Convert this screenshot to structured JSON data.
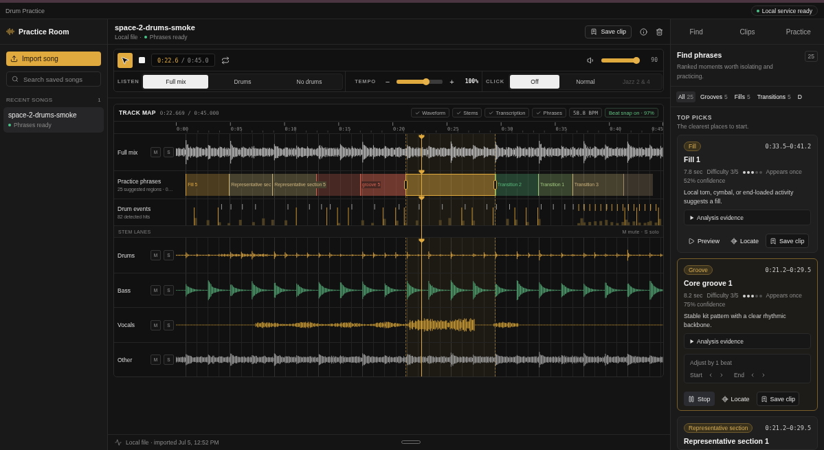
{
  "app": {
    "title": "Drum Practice",
    "service_status": "Local service ready"
  },
  "sidebar": {
    "brand": "Practice Room",
    "import_button": "Import song",
    "search": {
      "placeholder": "Search saved songs"
    },
    "recent_heading": "RECENT SONGS",
    "recent_count": "1",
    "songs": [
      {
        "name": "space-2-drums-smoke",
        "status": "Phrases ready",
        "selected": true
      }
    ]
  },
  "song": {
    "title": "space-2-drums-smoke",
    "source": "Local file",
    "separator": "·",
    "status": "Phrases ready",
    "save_button": "Save clip"
  },
  "transport": {
    "time": "0:22.6",
    "time_separator": "/",
    "duration": "0:45.0",
    "volume": {
      "level": 0.9,
      "reading": "90"
    }
  },
  "listen": {
    "label": "LISTEN",
    "options": [
      {
        "label": "Full mix",
        "selected": true
      },
      {
        "label": "Drums",
        "selected": false
      },
      {
        "label": "No drums",
        "selected": false
      }
    ]
  },
  "tempo": {
    "label": "TEMPO",
    "decrease": "−",
    "increase": "+",
    "level": 0.64,
    "reading": "100%"
  },
  "click": {
    "label": "CLICK",
    "options": [
      {
        "label": "Off",
        "selected": true,
        "disabled": false
      },
      {
        "label": "Normal",
        "selected": false,
        "disabled": false
      },
      {
        "label": "Jazz 2 & 4",
        "selected": false,
        "disabled": true
      }
    ]
  },
  "track_map": {
    "title": "TRACK MAP",
    "position": "0:22.669",
    "separator": "/",
    "duration": "0:45.000",
    "layers": [
      {
        "label": "Waveform",
        "checked": true
      },
      {
        "label": "Stems",
        "checked": true
      },
      {
        "label": "Transcription",
        "checked": true
      },
      {
        "label": "Phrases",
        "checked": true
      }
    ],
    "bpm": "58.8 BPM",
    "beat_snap": "Beat snap on · 97%",
    "ruler": [
      "0:00",
      "0:05",
      "0:10",
      "0:15",
      "0:20",
      "0:25",
      "0:30",
      "0:35",
      "0:40",
      "0:45"
    ],
    "playhead": {
      "level": 0.504
    },
    "full_mix": {
      "name": "Full mix",
      "mute": "M",
      "solo": "S"
    },
    "phrases": {
      "name": "Practice phrases",
      "detail": "25 suggested regions · 0…",
      "regions": [
        {
          "label": "Fill 5",
          "color": "#d9a441",
          "selected": false
        },
        {
          "label": "Representative sec",
          "color": "#c9b27a",
          "selected": false
        },
        {
          "label": "Representative section 5",
          "color": "#c9b27a",
          "selected": false
        },
        {
          "color": "#d0604f",
          "selected": false
        },
        {
          "label": "groove 5",
          "color": "#d0604f",
          "selected": false
        },
        {
          "color": "#e0aa3e",
          "selected": true
        },
        {
          "label": "Transition 2",
          "color": "#57b87a",
          "selected": false
        },
        {
          "label": "Transition 1",
          "color": "#9cc27a",
          "selected": false
        },
        {
          "label": "Transition 3",
          "color": "#c9b27a",
          "selected": false
        },
        {
          "color": "#a08a6a",
          "selected": false
        }
      ]
    },
    "drum_events": {
      "name": "Drum events",
      "detail": "82 detected hits"
    },
    "stem_heading": "STEM LANES",
    "stem_hint": "M mute · S solo",
    "stems": [
      {
        "name": "Drums",
        "mute": "M",
        "solo": "S",
        "color": "#d9a441"
      },
      {
        "name": "Bass",
        "mute": "M",
        "solo": "S",
        "color": "#4f9e6e"
      },
      {
        "name": "Vocals",
        "mute": "M",
        "solo": "S",
        "color": "#c99a34"
      },
      {
        "name": "Other",
        "mute": "M",
        "solo": "S",
        "color": "#9d9d9d"
      }
    ]
  },
  "status_bar": {
    "text": "Local file · imported Jul 5, 12:52 PM"
  },
  "panel": {
    "tabs": [
      {
        "label": "Find"
      },
      {
        "label": "Clips"
      },
      {
        "label": "Practice"
      }
    ],
    "title": "Find phrases",
    "subtitle": "Ranked moments worth isolating and practicing.",
    "count": "25",
    "filters": [
      {
        "label": "All",
        "count": "25",
        "selected": true
      },
      {
        "label": "Grooves",
        "count": "5",
        "selected": false
      },
      {
        "label": "Fills",
        "count": "5",
        "selected": false
      },
      {
        "label": "Transitions",
        "count": "5",
        "selected": false
      },
      {
        "label": "D",
        "selected": false
      }
    ],
    "section_heading": "TOP PICKS",
    "section_subtitle": "The clearest places to start.",
    "cards": [
      {
        "tag": "Fill",
        "range": "0:33.5–0:41.2",
        "title": "Fill 1",
        "duration": "7.8 sec",
        "difficulty": "Difficulty 3/5",
        "stars": 3,
        "repeats": "Appears once",
        "confidence": "52% confidence",
        "description": "Local tom, cymbal, or end-loaded activity suggests a fill.",
        "evidence": {
          "label": "Analysis evidence",
          "expanded": false
        },
        "selected": false,
        "actions": [
          {
            "kind": "preview",
            "label": "Preview"
          },
          {
            "kind": "locate",
            "label": "Locate"
          },
          {
            "kind": "save",
            "label": "Save clip"
          }
        ]
      },
      {
        "tag": "Groove",
        "range": "0:21.2–0:29.5",
        "title": "Core groove 1",
        "duration": "8.2 sec",
        "difficulty": "Difficulty 3/5",
        "stars": 3,
        "repeats": "Appears once",
        "confidence": "75% confidence",
        "description": "Stable kit pattern with a clear rhythmic backbone.",
        "evidence": {
          "label": "Analysis evidence",
          "expanded": false
        },
        "adjust": {
          "title": "Adjust by 1 beat",
          "start": "Start",
          "end": "End"
        },
        "selected": true,
        "actions": [
          {
            "kind": "stop",
            "label": "Stop"
          },
          {
            "kind": "locate",
            "label": "Locate"
          },
          {
            "kind": "save",
            "label": "Save clip"
          }
        ]
      },
      {
        "tag": "Representative section",
        "range": "0:21.2–0:29.5",
        "title": "Representative section 1",
        "selected": false
      }
    ]
  }
}
